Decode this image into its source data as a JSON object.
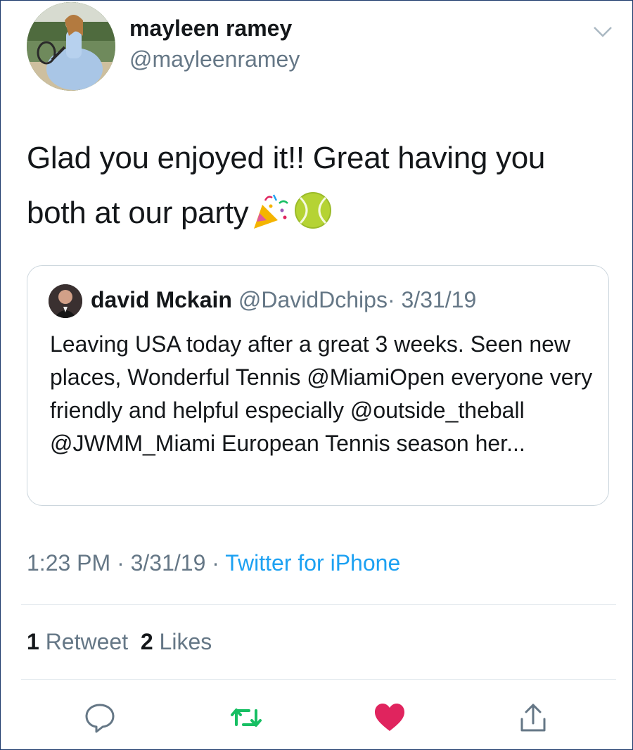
{
  "author": {
    "name": "mayleen ramey",
    "handle": "@mayleenramey"
  },
  "tweet": {
    "text": "Glad you enjoyed it!! Great having you both at our party",
    "emojis": [
      "party-popper-icon",
      "tennis-ball-icon"
    ]
  },
  "quoted_tweet": {
    "name": "david Mckain",
    "handle": "@DavidDchips",
    "separator": "·",
    "date": "3/31/19",
    "text": "Leaving USA today after a great 3 weeks. Seen new places, Wonderful Tennis @MiamiOpen everyone very friendly and helpful especially @outside_theball @JWMM_Miami European Tennis season her..."
  },
  "meta": {
    "time": "1:23 PM",
    "separator": "·",
    "date": "3/31/19",
    "source": "Twitter for iPhone"
  },
  "stats": {
    "retweets_count": "1",
    "retweets_label": "Retweet",
    "likes_count": "2",
    "likes_label": "Likes"
  },
  "actions": [
    "reply-icon",
    "retweet-icon",
    "like-icon",
    "share-icon"
  ],
  "colors": {
    "link": "#1da1f2",
    "secondary_text": "#657786",
    "retweet_green": "#17bf63",
    "like_red": "#e0245e",
    "border": "#ccd6dd"
  }
}
